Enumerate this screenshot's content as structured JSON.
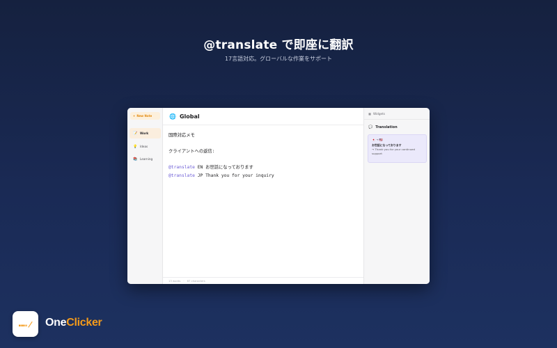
{
  "hero": {
    "title": "@translate で即座に翻訳",
    "subtitle": "17言語対応。グローバルな作業をサポート"
  },
  "sidebar": {
    "new_note_icon": "+",
    "new_note_label": "New Note",
    "items": [
      {
        "icon": "📝",
        "icon_name": "memo-icon",
        "label": "Work",
        "active": true
      },
      {
        "icon": "💡",
        "icon_name": "lightbulb-icon",
        "label": "Ideas",
        "active": false
      },
      {
        "icon": "📚",
        "icon_name": "books-icon",
        "label": "Learning",
        "active": false
      }
    ]
  },
  "note": {
    "icon": "🌐",
    "title": "Global",
    "lines": [
      {
        "cmd": "",
        "text": "国際対応メモ"
      },
      {
        "cmd": "",
        "text": ""
      },
      {
        "cmd": "",
        "text": "クライアントへの返信:"
      },
      {
        "cmd": "",
        "text": ""
      },
      {
        "cmd": "@translate",
        "text": " EN お世話になっております"
      },
      {
        "cmd": "@translate",
        "text": " JP Thank you for your inquiry"
      }
    ],
    "word_count": "13 words",
    "char_count": "67 characters"
  },
  "widgets": {
    "header_icon": "▦",
    "header_label": "Widgets",
    "section_icon": "💬",
    "section_label": "Translation",
    "card": {
      "flags": "🇯🇵 → 🇺🇸",
      "source": "お世話になっております",
      "result": "→ Thank you for your continued support"
    }
  },
  "brand": {
    "name_part1": "One",
    "name_part2": "Clicker",
    "accent_color": "#f49b1a"
  }
}
